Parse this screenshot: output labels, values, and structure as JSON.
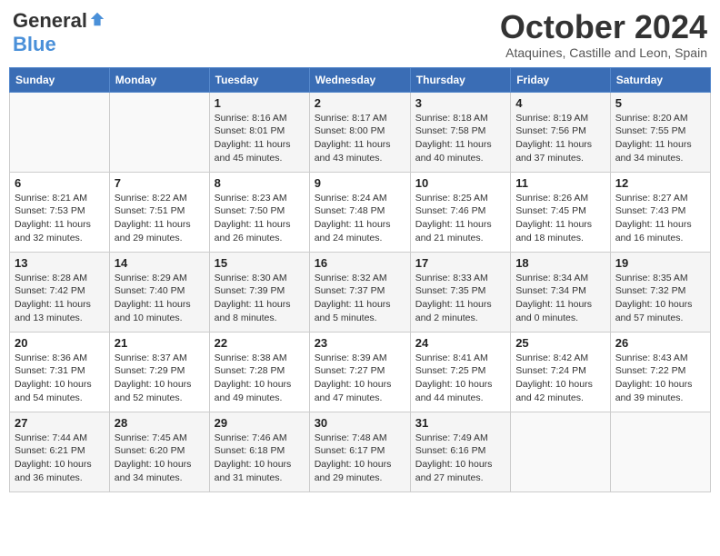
{
  "header": {
    "logo_general": "General",
    "logo_blue": "Blue",
    "month_title": "October 2024",
    "location": "Ataquines, Castille and Leon, Spain"
  },
  "columns": [
    "Sunday",
    "Monday",
    "Tuesday",
    "Wednesday",
    "Thursday",
    "Friday",
    "Saturday"
  ],
  "weeks": [
    [
      {
        "day": "",
        "sunrise": "",
        "sunset": "",
        "daylight": ""
      },
      {
        "day": "",
        "sunrise": "",
        "sunset": "",
        "daylight": ""
      },
      {
        "day": "1",
        "sunrise": "Sunrise: 8:16 AM",
        "sunset": "Sunset: 8:01 PM",
        "daylight": "Daylight: 11 hours and 45 minutes."
      },
      {
        "day": "2",
        "sunrise": "Sunrise: 8:17 AM",
        "sunset": "Sunset: 8:00 PM",
        "daylight": "Daylight: 11 hours and 43 minutes."
      },
      {
        "day": "3",
        "sunrise": "Sunrise: 8:18 AM",
        "sunset": "Sunset: 7:58 PM",
        "daylight": "Daylight: 11 hours and 40 minutes."
      },
      {
        "day": "4",
        "sunrise": "Sunrise: 8:19 AM",
        "sunset": "Sunset: 7:56 PM",
        "daylight": "Daylight: 11 hours and 37 minutes."
      },
      {
        "day": "5",
        "sunrise": "Sunrise: 8:20 AM",
        "sunset": "Sunset: 7:55 PM",
        "daylight": "Daylight: 11 hours and 34 minutes."
      }
    ],
    [
      {
        "day": "6",
        "sunrise": "Sunrise: 8:21 AM",
        "sunset": "Sunset: 7:53 PM",
        "daylight": "Daylight: 11 hours and 32 minutes."
      },
      {
        "day": "7",
        "sunrise": "Sunrise: 8:22 AM",
        "sunset": "Sunset: 7:51 PM",
        "daylight": "Daylight: 11 hours and 29 minutes."
      },
      {
        "day": "8",
        "sunrise": "Sunrise: 8:23 AM",
        "sunset": "Sunset: 7:50 PM",
        "daylight": "Daylight: 11 hours and 26 minutes."
      },
      {
        "day": "9",
        "sunrise": "Sunrise: 8:24 AM",
        "sunset": "Sunset: 7:48 PM",
        "daylight": "Daylight: 11 hours and 24 minutes."
      },
      {
        "day": "10",
        "sunrise": "Sunrise: 8:25 AM",
        "sunset": "Sunset: 7:46 PM",
        "daylight": "Daylight: 11 hours and 21 minutes."
      },
      {
        "day": "11",
        "sunrise": "Sunrise: 8:26 AM",
        "sunset": "Sunset: 7:45 PM",
        "daylight": "Daylight: 11 hours and 18 minutes."
      },
      {
        "day": "12",
        "sunrise": "Sunrise: 8:27 AM",
        "sunset": "Sunset: 7:43 PM",
        "daylight": "Daylight: 11 hours and 16 minutes."
      }
    ],
    [
      {
        "day": "13",
        "sunrise": "Sunrise: 8:28 AM",
        "sunset": "Sunset: 7:42 PM",
        "daylight": "Daylight: 11 hours and 13 minutes."
      },
      {
        "day": "14",
        "sunrise": "Sunrise: 8:29 AM",
        "sunset": "Sunset: 7:40 PM",
        "daylight": "Daylight: 11 hours and 10 minutes."
      },
      {
        "day": "15",
        "sunrise": "Sunrise: 8:30 AM",
        "sunset": "Sunset: 7:39 PM",
        "daylight": "Daylight: 11 hours and 8 minutes."
      },
      {
        "day": "16",
        "sunrise": "Sunrise: 8:32 AM",
        "sunset": "Sunset: 7:37 PM",
        "daylight": "Daylight: 11 hours and 5 minutes."
      },
      {
        "day": "17",
        "sunrise": "Sunrise: 8:33 AM",
        "sunset": "Sunset: 7:35 PM",
        "daylight": "Daylight: 11 hours and 2 minutes."
      },
      {
        "day": "18",
        "sunrise": "Sunrise: 8:34 AM",
        "sunset": "Sunset: 7:34 PM",
        "daylight": "Daylight: 11 hours and 0 minutes."
      },
      {
        "day": "19",
        "sunrise": "Sunrise: 8:35 AM",
        "sunset": "Sunset: 7:32 PM",
        "daylight": "Daylight: 10 hours and 57 minutes."
      }
    ],
    [
      {
        "day": "20",
        "sunrise": "Sunrise: 8:36 AM",
        "sunset": "Sunset: 7:31 PM",
        "daylight": "Daylight: 10 hours and 54 minutes."
      },
      {
        "day": "21",
        "sunrise": "Sunrise: 8:37 AM",
        "sunset": "Sunset: 7:29 PM",
        "daylight": "Daylight: 10 hours and 52 minutes."
      },
      {
        "day": "22",
        "sunrise": "Sunrise: 8:38 AM",
        "sunset": "Sunset: 7:28 PM",
        "daylight": "Daylight: 10 hours and 49 minutes."
      },
      {
        "day": "23",
        "sunrise": "Sunrise: 8:39 AM",
        "sunset": "Sunset: 7:27 PM",
        "daylight": "Daylight: 10 hours and 47 minutes."
      },
      {
        "day": "24",
        "sunrise": "Sunrise: 8:41 AM",
        "sunset": "Sunset: 7:25 PM",
        "daylight": "Daylight: 10 hours and 44 minutes."
      },
      {
        "day": "25",
        "sunrise": "Sunrise: 8:42 AM",
        "sunset": "Sunset: 7:24 PM",
        "daylight": "Daylight: 10 hours and 42 minutes."
      },
      {
        "day": "26",
        "sunrise": "Sunrise: 8:43 AM",
        "sunset": "Sunset: 7:22 PM",
        "daylight": "Daylight: 10 hours and 39 minutes."
      }
    ],
    [
      {
        "day": "27",
        "sunrise": "Sunrise: 7:44 AM",
        "sunset": "Sunset: 6:21 PM",
        "daylight": "Daylight: 10 hours and 36 minutes."
      },
      {
        "day": "28",
        "sunrise": "Sunrise: 7:45 AM",
        "sunset": "Sunset: 6:20 PM",
        "daylight": "Daylight: 10 hours and 34 minutes."
      },
      {
        "day": "29",
        "sunrise": "Sunrise: 7:46 AM",
        "sunset": "Sunset: 6:18 PM",
        "daylight": "Daylight: 10 hours and 31 minutes."
      },
      {
        "day": "30",
        "sunrise": "Sunrise: 7:48 AM",
        "sunset": "Sunset: 6:17 PM",
        "daylight": "Daylight: 10 hours and 29 minutes."
      },
      {
        "day": "31",
        "sunrise": "Sunrise: 7:49 AM",
        "sunset": "Sunset: 6:16 PM",
        "daylight": "Daylight: 10 hours and 27 minutes."
      },
      {
        "day": "",
        "sunrise": "",
        "sunset": "",
        "daylight": ""
      },
      {
        "day": "",
        "sunrise": "",
        "sunset": "",
        "daylight": ""
      }
    ]
  ]
}
